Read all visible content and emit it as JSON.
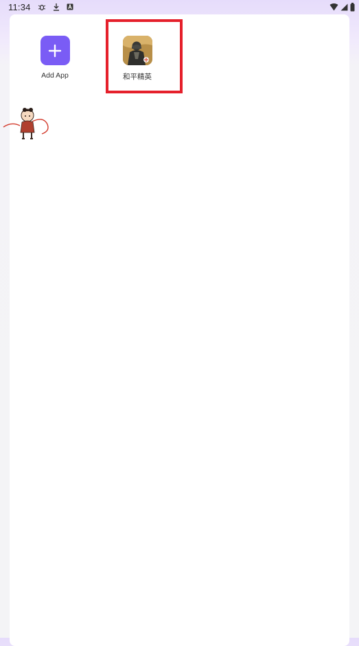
{
  "status_bar": {
    "time": "11:34",
    "icons_left": [
      "bug-icon",
      "download-icon",
      "a-badge-icon"
    ],
    "icons_right": [
      "wifi-icon",
      "cell-signal-icon",
      "battery-icon"
    ]
  },
  "apps": [
    {
      "label": "Add App",
      "icon": "plus-icon"
    },
    {
      "label": "和平精英",
      "icon": "game-character-icon"
    }
  ],
  "colors": {
    "accent": "#7a5cf5",
    "highlight": "#e5202b"
  }
}
